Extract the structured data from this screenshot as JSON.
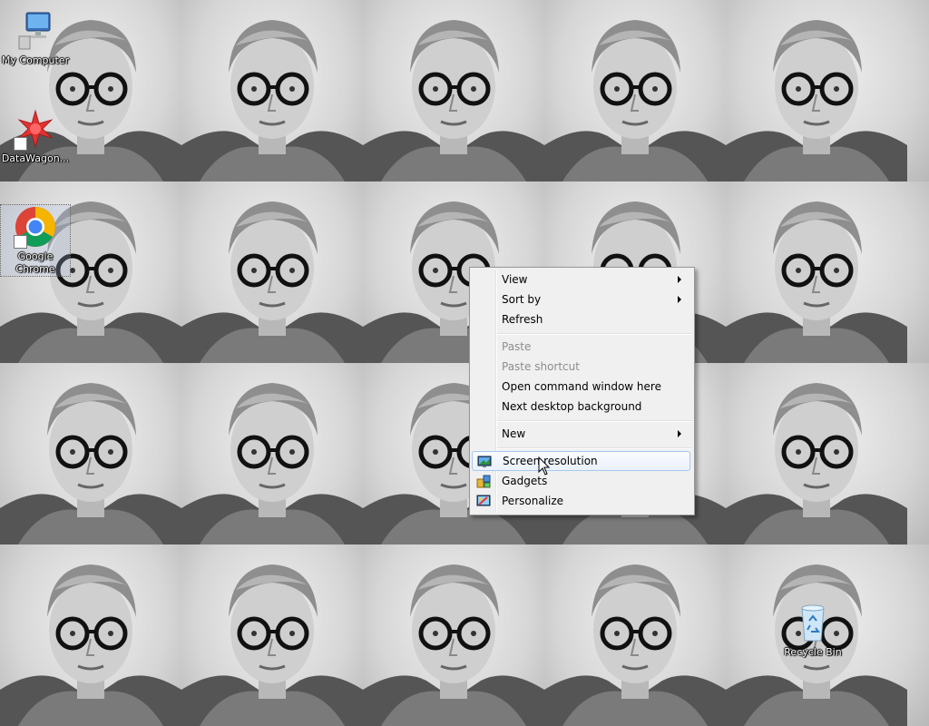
{
  "desktop": {
    "wallpaper": "tiled black-and-white portrait of a man with glasses",
    "icons": [
      {
        "label": "My Computer",
        "icon": "computer-icon"
      },
      {
        "label": "DataWagon...",
        "icon": "datawagon-icon",
        "shortcut": true
      },
      {
        "label": "Google Chrome",
        "icon": "chrome-icon",
        "shortcut": true,
        "selected": true
      },
      {
        "label": "Recycle Bin",
        "icon": "recycle-bin-icon"
      }
    ]
  },
  "context_menu": {
    "items": [
      {
        "label": "View",
        "submenu": true
      },
      {
        "label": "Sort by",
        "submenu": true
      },
      {
        "label": "Refresh"
      },
      {
        "label": "Paste",
        "disabled": true
      },
      {
        "label": "Paste shortcut",
        "disabled": true
      },
      {
        "label": "Open command window here"
      },
      {
        "label": "Next desktop background"
      },
      {
        "label": "New",
        "submenu": true
      },
      {
        "label": "Screen resolution",
        "icon": "monitor-icon",
        "hover": true
      },
      {
        "label": "Gadgets",
        "icon": "gadgets-icon"
      },
      {
        "label": "Personalize",
        "icon": "personalize-icon"
      }
    ]
  },
  "colors": {
    "menu_bg": "#f0f0f0",
    "menu_hover_border": "#a8c7ef",
    "disabled_text": "#8d8d8d"
  }
}
